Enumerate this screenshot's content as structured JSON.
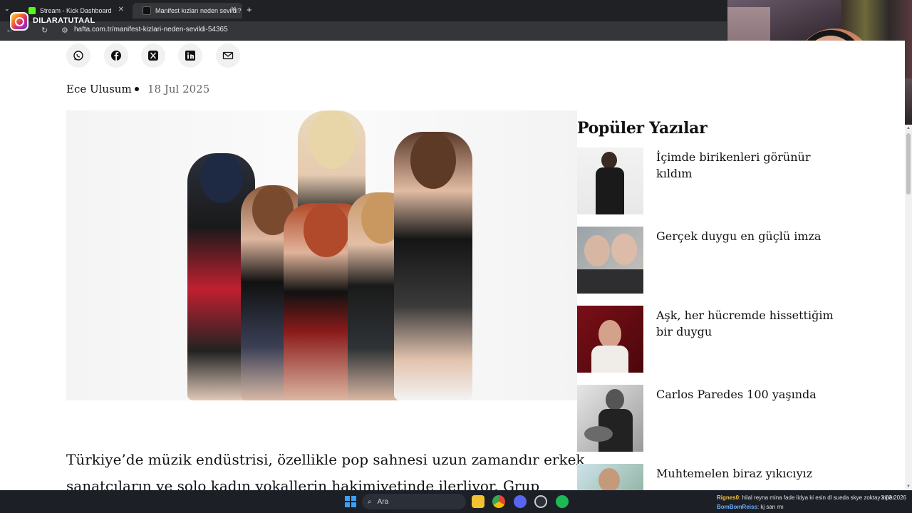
{
  "browser": {
    "tabs": [
      {
        "label": "Stream - Kick Dashboard",
        "active": false
      },
      {
        "label": "Manifest kızları neden sevildi?",
        "active": true
      }
    ],
    "url": "hafta.com.tr/manifest-kizlari-neden-sevildi-54365"
  },
  "overlay": {
    "instagram_handle": "DILARATUTAAL"
  },
  "article": {
    "share_icons": [
      "whatsapp-icon",
      "facebook-icon",
      "x-icon",
      "linkedin-icon",
      "mail-icon"
    ],
    "author": "Ece Ulusum",
    "date": "18 Jul 2025",
    "lede": "Türkiye’de müzik endüstrisi, özellikle pop sahnesi uzun zamandır erkek sanatçıların ve solo kadın vokallerin hakimiyetinde ilerliyor. Grup kültürü"
  },
  "sidebar": {
    "title": "Popüler Yazılar",
    "items": [
      {
        "title": "İçimde birikenleri görünür kıldım"
      },
      {
        "title": "Gerçek duygu en güçlü imza"
      },
      {
        "title": "Aşk, her hücremde hissettiğim bir duygu"
      },
      {
        "title": "Carlos Paredes 100 yaşında"
      },
      {
        "title": "Muhtemelen biraz yıkıcıyız"
      }
    ]
  },
  "taskbar": {
    "search_placeholder": "Ara",
    "chat": [
      {
        "user": "Rignes0",
        "text": ": hilal reyna mina fade lidya ki esin dl sueda skye zoktay viper"
      },
      {
        "user": "BomBomReiss",
        "text": ": kj sarı mı"
      }
    ],
    "time": "",
    "date": "3.03.2026"
  },
  "colors": {
    "chrome_bg": "#202124",
    "active_tab": "#35363a",
    "taskbar_bg": "#1c1f26"
  }
}
